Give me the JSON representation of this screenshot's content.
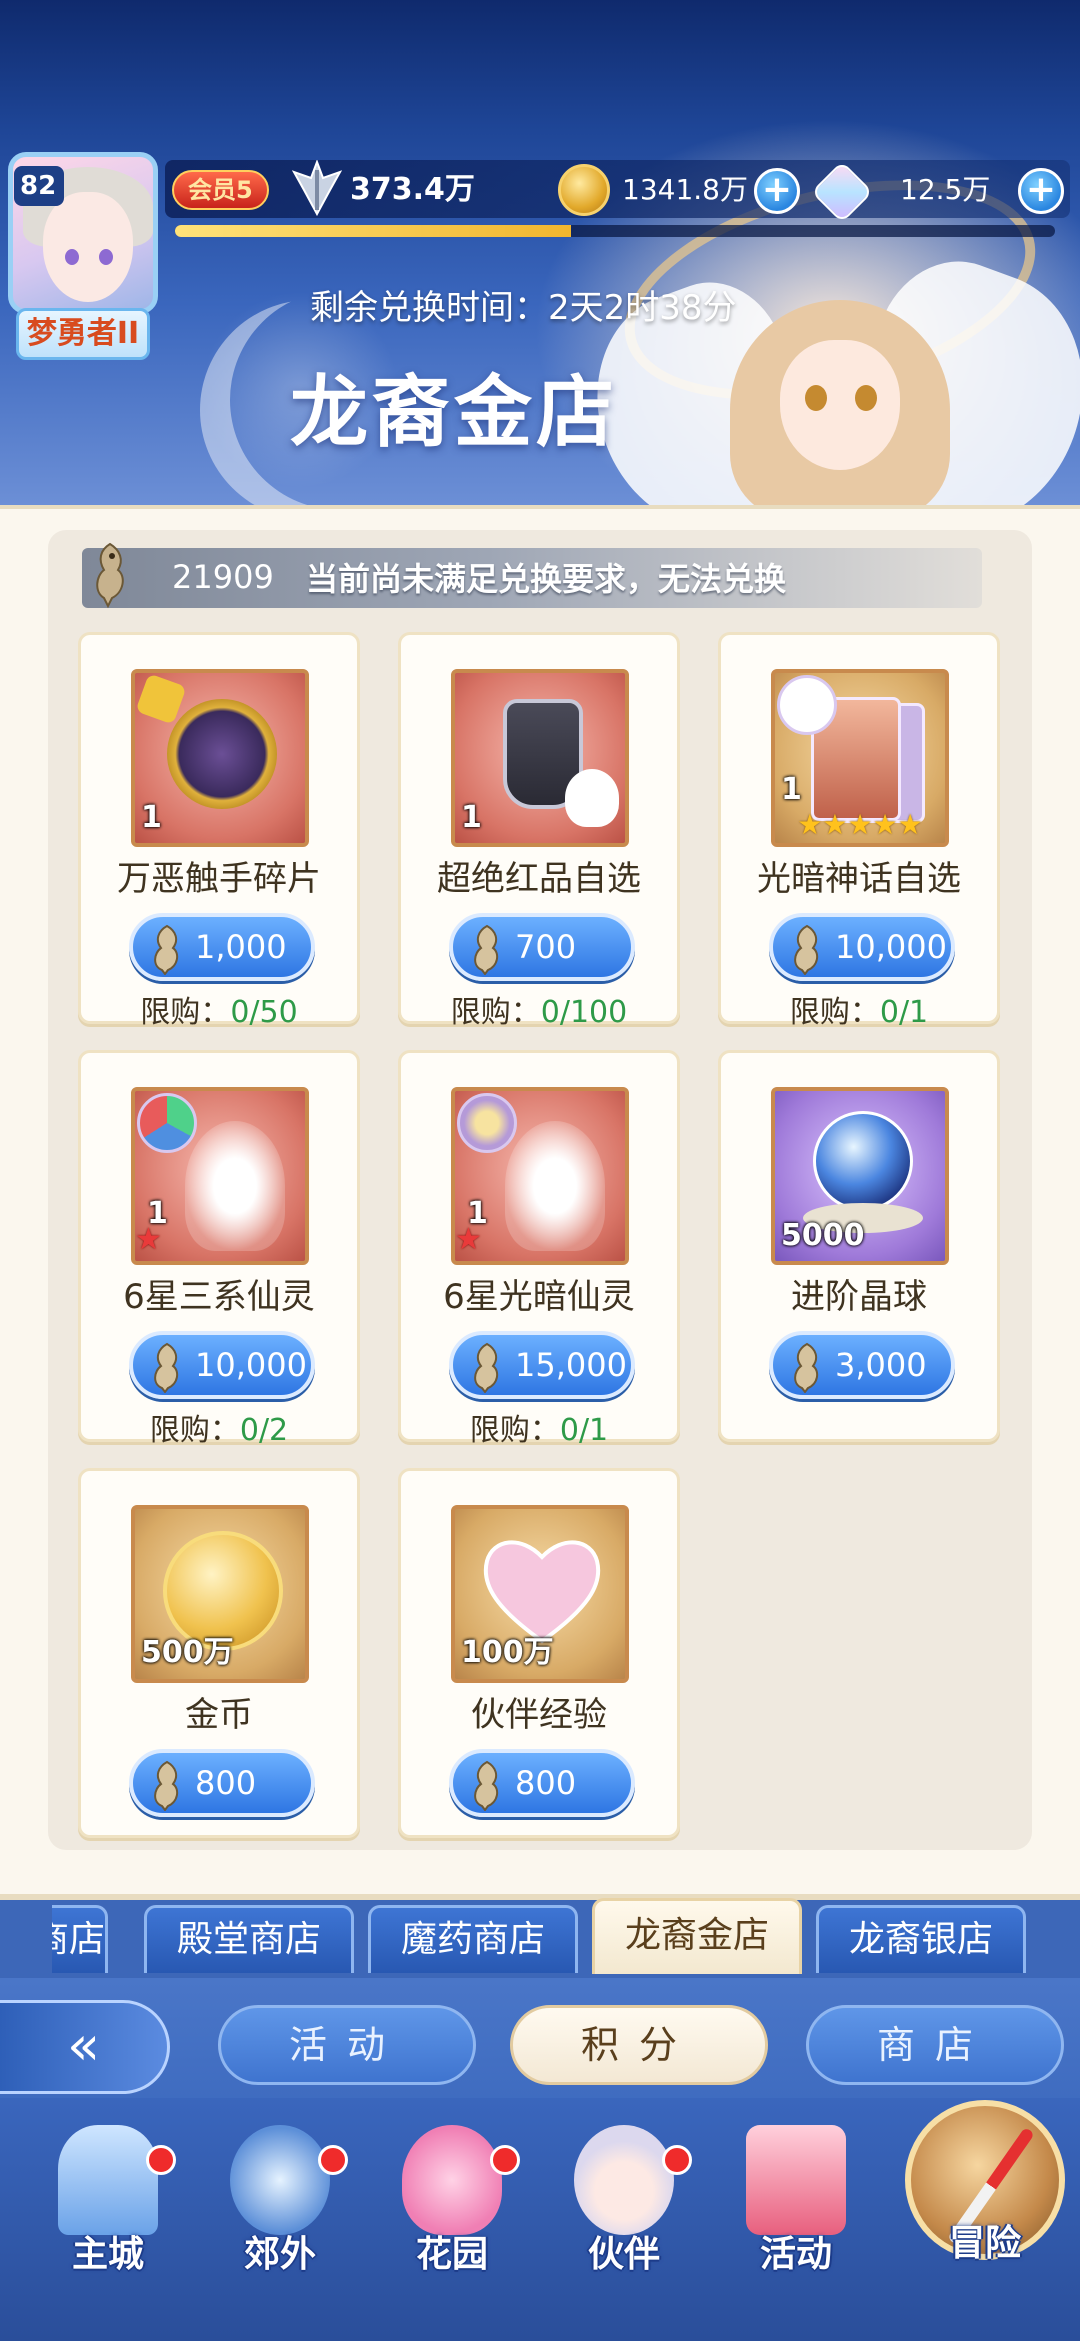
{
  "header": {
    "level": "82",
    "player_title": "梦勇者II",
    "vip": "会员5",
    "power": "373.4万",
    "gold": "1341.8万",
    "gems": "12.5万",
    "xp_progress": 0.45,
    "remaining_label": "剩余兑换时间：2天2时38分",
    "shop_title": "龙裔金店"
  },
  "notice": {
    "count": "21909",
    "text": "当前尚未满足兑换要求，无法兑换"
  },
  "items": [
    {
      "name": "万恶触手碎片",
      "qty": "1",
      "price": "1,000",
      "limit_label": "限购：",
      "limit_value": "0/50"
    },
    {
      "name": "超绝红品自选",
      "qty": "1",
      "price": "700",
      "limit_label": "限购：",
      "limit_value": "0/100"
    },
    {
      "name": "光暗神话自选",
      "qty": "1",
      "stars": "★★★★★",
      "price": "10,000",
      "limit_label": "限购：",
      "limit_value": "0/1"
    },
    {
      "name": "6星三系仙灵",
      "qty": "1",
      "star_mark": "★",
      "price": "10,000",
      "limit_label": "限购：",
      "limit_value": "0/2"
    },
    {
      "name": "6星光暗仙灵",
      "qty": "1",
      "star_mark": "★",
      "price": "15,000",
      "limit_label": "限购：",
      "limit_value": "0/1"
    },
    {
      "name": "进阶晶球",
      "qty": "5000",
      "price": "3,000"
    },
    {
      "name": "金币",
      "qty": "500万",
      "price": "800"
    },
    {
      "name": "伙伴经验",
      "qty": "100万",
      "price": "800"
    }
  ],
  "tabs": [
    {
      "label": "商店"
    },
    {
      "label": "殿堂商店"
    },
    {
      "label": "魔药商店"
    },
    {
      "label": "龙裔金店"
    },
    {
      "label": "龙裔银店"
    }
  ],
  "sub_nav": {
    "back": "«",
    "activity": "活动",
    "points": "积分",
    "shop": "商店"
  },
  "bottom_nav": {
    "main_city": "主城",
    "suburbs": "郊外",
    "garden": "花园",
    "partner": "伙伴",
    "activity": "活动",
    "adventure": "冒险"
  },
  "colors": {
    "price_button": "#2e76e3",
    "limit_value": "#2e9a48",
    "badge_red": "#ef2b2b",
    "banner_top": "#0f2a6d"
  }
}
